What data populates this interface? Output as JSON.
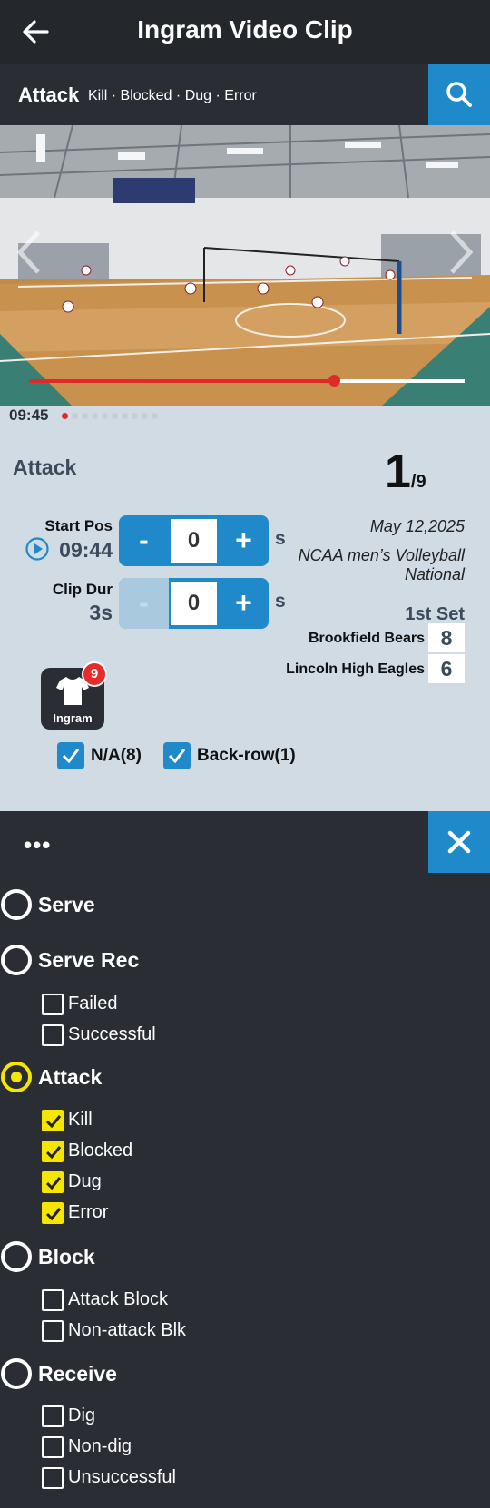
{
  "header": {
    "title": "Ingram Video Clip"
  },
  "filter": {
    "category": "Attack",
    "subtypes": "Kill · Blocked · Dug · Error"
  },
  "video": {
    "time": "09:45",
    "progress": 0.7,
    "clip_dots": 10,
    "active_dot": 0
  },
  "panel": {
    "category": "Attack",
    "current": "1",
    "total": "/9",
    "start_pos_label": "Start Pos",
    "start_pos_value": "09:44",
    "start_offset": "0",
    "clip_dur_label": "Clip Dur",
    "clip_dur_value": "3s",
    "clip_offset": "0",
    "unit": "s",
    "minus": "-",
    "plus": "+",
    "date": "May 12,2025",
    "league": "NCAA men’s Volleyball National",
    "set": "1st Set",
    "teams": [
      {
        "name": "Brookfield Bears",
        "score": "8"
      },
      {
        "name": "Lincoln High Eagles",
        "score": "6"
      }
    ],
    "player": {
      "name": "Ingram",
      "badge": "9"
    },
    "checks": [
      {
        "label": "N/A(8)",
        "checked": true
      },
      {
        "label": "Back-row(1)",
        "checked": true
      }
    ]
  },
  "filters": {
    "more_label": "•••",
    "groups": [
      {
        "label": "Serve",
        "selected": false,
        "options": []
      },
      {
        "label": "Serve Rec",
        "selected": false,
        "options": [
          "Failed",
          "Successful"
        ]
      },
      {
        "label": "Attack",
        "selected": true,
        "options": [
          "Kill",
          "Blocked",
          "Dug",
          "Error"
        ]
      },
      {
        "label": "Block",
        "selected": false,
        "options": [
          "Attack Block",
          "Non-attack Blk"
        ]
      },
      {
        "label": "Receive",
        "selected": false,
        "options": [
          "Dig",
          "Non-dig",
          "Unsuccessful"
        ]
      }
    ]
  },
  "colors": {
    "accent": "#1f8ac9",
    "highlight": "#f5e600",
    "progress": "#e02a2a",
    "dark": "#2a2d33",
    "panel": "#d0dbe3"
  }
}
